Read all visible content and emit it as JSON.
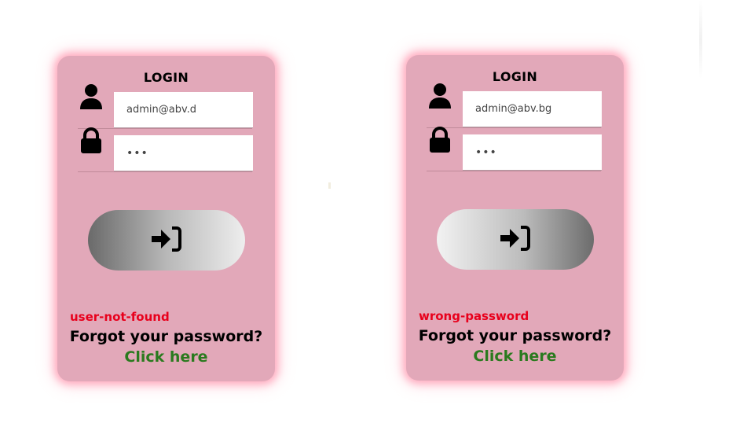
{
  "cards": {
    "left": {
      "title": "LOGIN",
      "email_value": "admin@abv.d",
      "password_value": "•••",
      "error": "user-not-found",
      "forgot": "Forgot your password?",
      "click_here": "Click here"
    },
    "right": {
      "title": "LOGIN",
      "email_value": "admin@abv.bg",
      "password_value": "•••",
      "error": "wrong-password",
      "forgot": "Forgot your password?",
      "click_here": "Click here"
    }
  },
  "icons": {
    "user": "user-icon",
    "lock": "lock-icon",
    "login": "sign-in-icon"
  },
  "colors": {
    "card_bg": "#e2a8b9",
    "error": "#e8001c",
    "link": "#2a7a1e",
    "glow": "#ff96af"
  }
}
